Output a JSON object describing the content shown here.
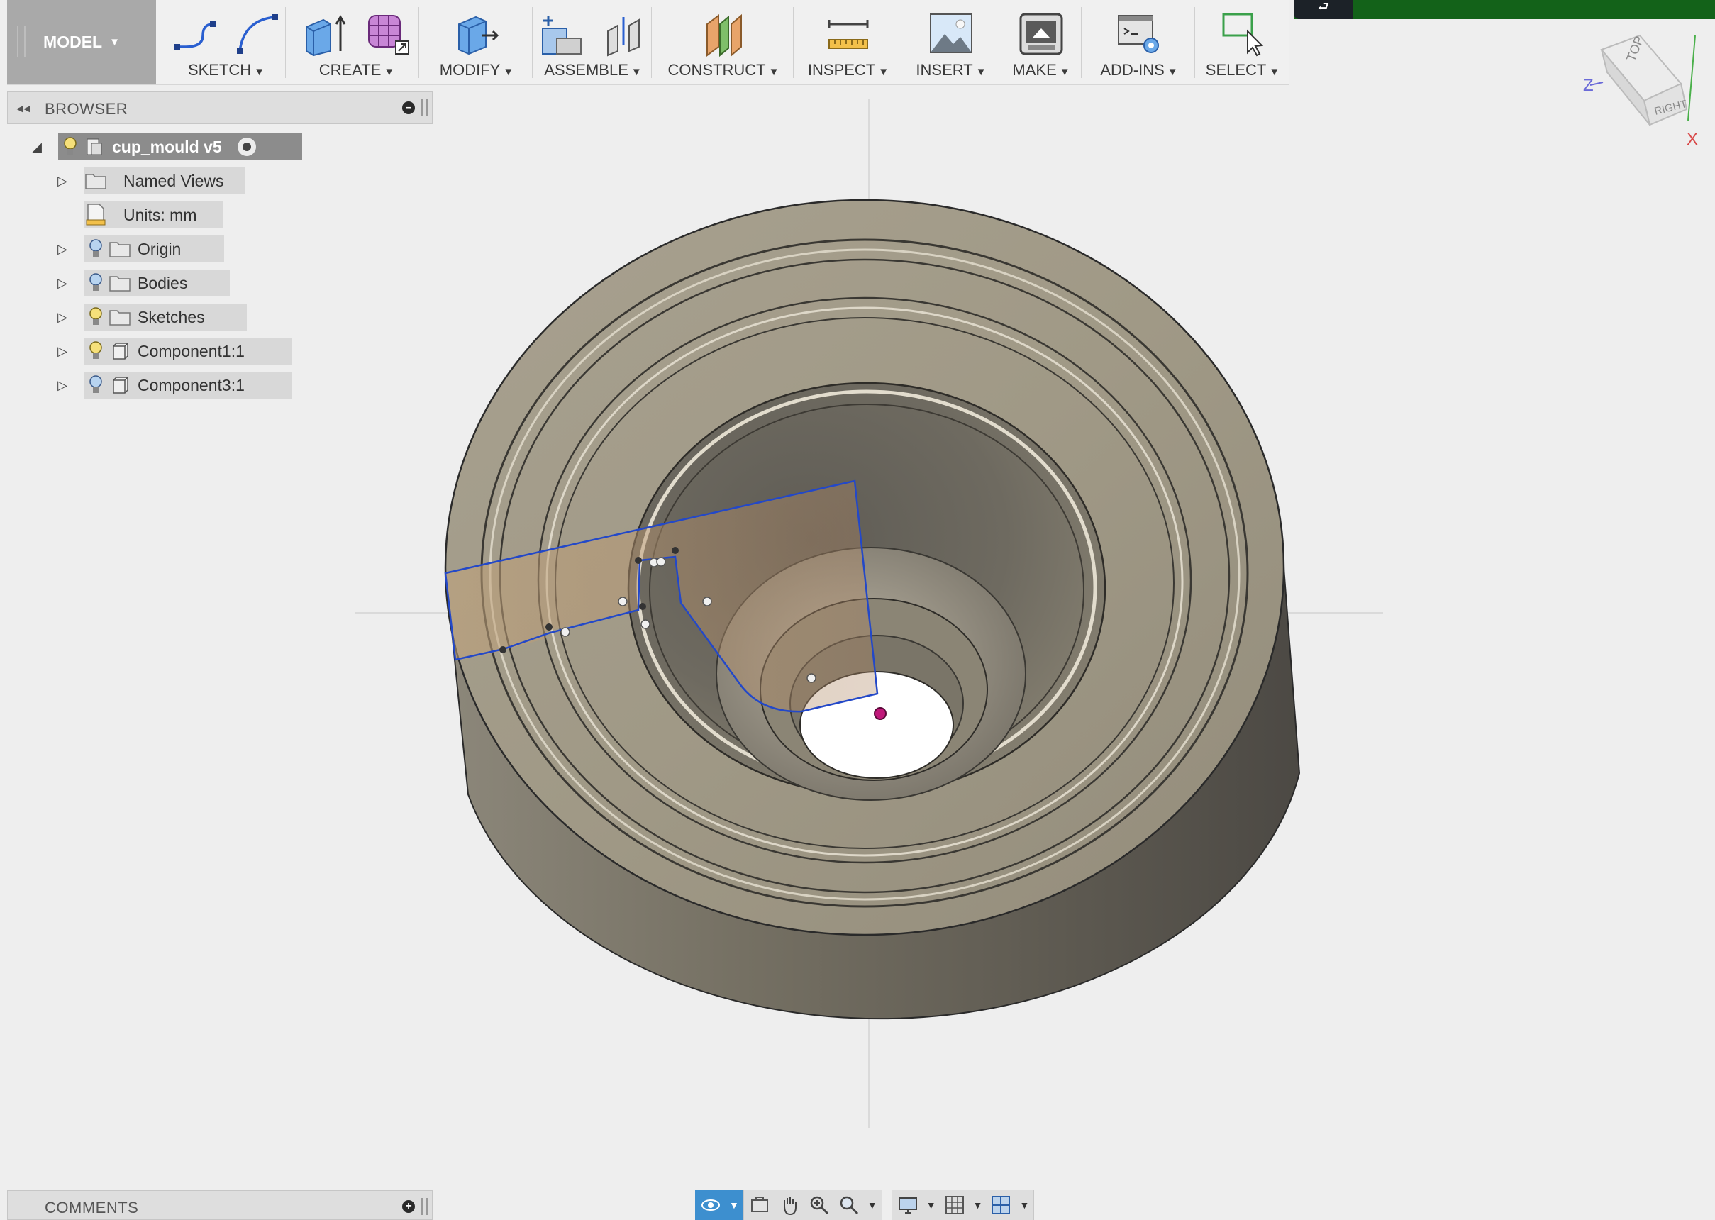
{
  "toolbar": {
    "workspace": "MODEL",
    "groups": [
      {
        "label": "SKETCH",
        "icons": [
          "sketch-line-icon",
          "sketch-arc-icon"
        ]
      },
      {
        "label": "CREATE",
        "icons": [
          "extrude-box-icon",
          "form-grid-icon"
        ]
      },
      {
        "label": "MODIFY",
        "icons": [
          "press-pull-icon"
        ]
      },
      {
        "label": "ASSEMBLE",
        "icons": [
          "new-component-icon",
          "joint-icon"
        ]
      },
      {
        "label": "CONSTRUCT",
        "icons": [
          "construct-plane-icon"
        ]
      },
      {
        "label": "INSPECT",
        "icons": [
          "measure-ruler-icon"
        ]
      },
      {
        "label": "INSERT",
        "icons": [
          "insert-image-icon"
        ]
      },
      {
        "label": "MAKE",
        "icons": [
          "print-3d-icon"
        ]
      },
      {
        "label": "ADD-INS",
        "icons": [
          "scripts-icon"
        ]
      },
      {
        "label": "SELECT",
        "icons": [
          "select-cursor-icon"
        ]
      }
    ]
  },
  "browser": {
    "title": "BROWSER",
    "root": "cup_mould v5",
    "items": [
      {
        "label": "Named Views",
        "expandable": true,
        "visibility": false,
        "type": "folder"
      },
      {
        "label": "Units: mm",
        "expandable": false,
        "visibility": false,
        "type": "document"
      },
      {
        "label": "Origin",
        "expandable": true,
        "visibility": true,
        "type": "folder",
        "bulb": "off"
      },
      {
        "label": "Bodies",
        "expandable": true,
        "visibility": true,
        "type": "folder",
        "bulb": "off"
      },
      {
        "label": "Sketches",
        "expandable": true,
        "visibility": true,
        "type": "folder",
        "bulb": "on"
      },
      {
        "label": "Component1:1",
        "expandable": true,
        "visibility": true,
        "type": "component",
        "bulb": "on"
      },
      {
        "label": "Component3:1",
        "expandable": true,
        "visibility": true,
        "type": "component",
        "bulb": "off"
      }
    ]
  },
  "comments": {
    "title": "COMMENTS"
  },
  "viewcube": {
    "top": "TOP",
    "right": "RIGHT",
    "axis_z": "Z",
    "axis_x": "X"
  },
  "colors": {
    "toolbar_bg": "#f0f0f0",
    "workspace_btn": "#a9a9a9",
    "tree_chip": "#d8d8d8",
    "root_chip": "#8c8c8c",
    "status_green": "#136219",
    "sketch_blue": "#2348c8",
    "model_top": "#a19a89",
    "model_side": "#6f6b60",
    "nav_active": "#3d8fcf"
  }
}
